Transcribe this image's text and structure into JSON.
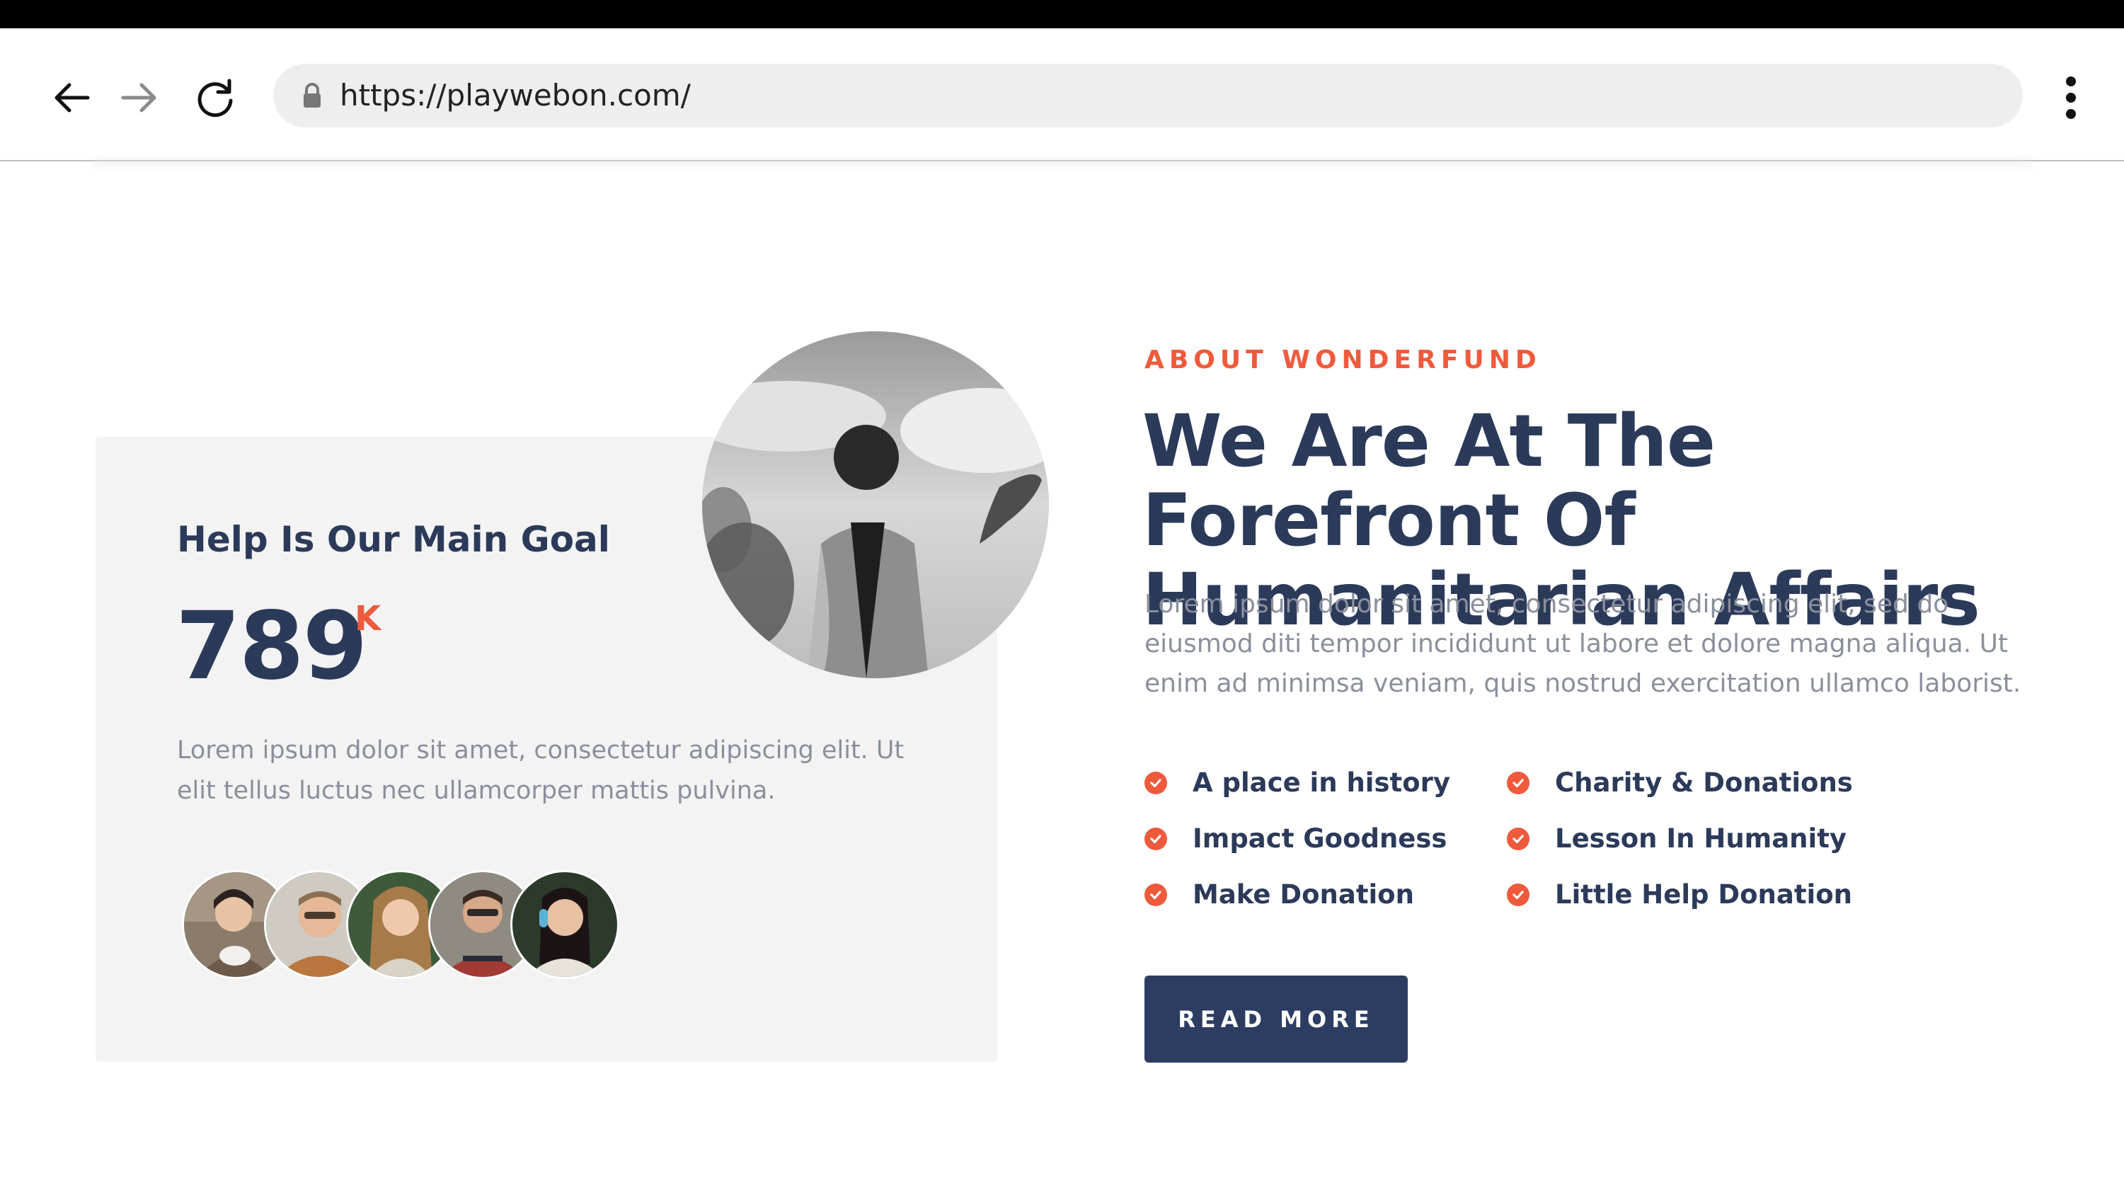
{
  "browser": {
    "url": "https://playwebon.com/",
    "icons": [
      "back-arrow-icon",
      "forward-arrow-icon",
      "reload-icon",
      "lock-icon",
      "more-menu-icon"
    ]
  },
  "card": {
    "title": "Help Is Our Main Goal",
    "counter_value": "789",
    "counter_suffix": "K",
    "text": "Lorem ipsum dolor sit amet, consectetur adipiscing elit. Ut elit tellus luctus nec ullamcorper mattis pulvina.",
    "avatar_count": 5
  },
  "about": {
    "eyebrow": "ABOUT WONDERFUND",
    "headline": "We Are At The Forefront Of Humanitarian Affairs",
    "lead": "Lorem ipsum dolor sit amet, consectetur adipiscing elit, sed do eiusmod diti tempor incididunt ut labore et dolore magna aliqua. Ut enim ad minimsa veniam, quis nostrud exercitation ullamco laborist.",
    "features": [
      "A place in history",
      "Impact Goodness",
      "Make Donation",
      "Charity & Donations",
      "Lesson In Humanity",
      "Little Help Donation"
    ],
    "button_label": "READ MORE"
  },
  "colors": {
    "accent": "#ef5a3c",
    "navy": "#2c3a5a",
    "button": "#2c3d61",
    "card_bg": "#f3f3f4",
    "muted_text": "#8a8f9c"
  }
}
